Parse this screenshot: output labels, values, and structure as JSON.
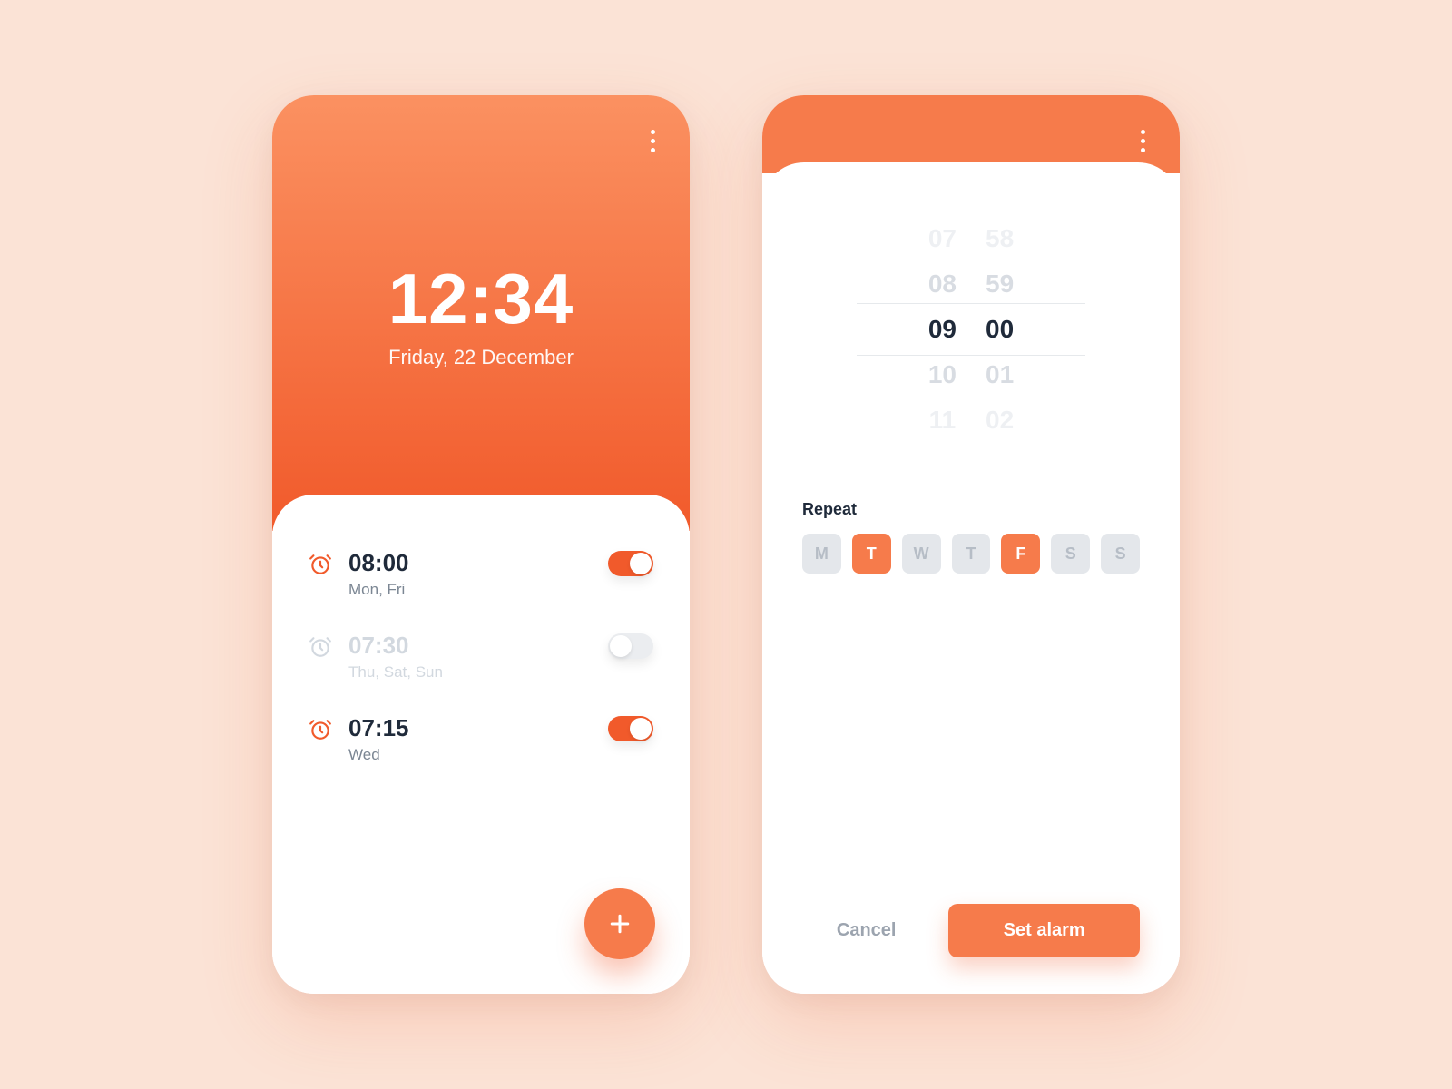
{
  "colors": {
    "accent": "#F67B4B"
  },
  "screen_main": {
    "time": "12:34",
    "date": "Friday, 22 December",
    "alarms": [
      {
        "time": "08:00",
        "days": "Mon, Fri",
        "enabled": true
      },
      {
        "time": "07:30",
        "days": "Thu, Sat, Sun",
        "enabled": false
      },
      {
        "time": "07:15",
        "days": "Wed",
        "enabled": true
      }
    ]
  },
  "screen_edit": {
    "picker": {
      "hours": [
        "07",
        "08",
        "09",
        "10",
        "11"
      ],
      "minutes": [
        "58",
        "59",
        "00",
        "01",
        "02"
      ],
      "selected_index": 2
    },
    "repeat_label": "Repeat",
    "days": [
      {
        "label": "M",
        "selected": false
      },
      {
        "label": "T",
        "selected": true
      },
      {
        "label": "W",
        "selected": false
      },
      {
        "label": "T",
        "selected": false
      },
      {
        "label": "F",
        "selected": true
      },
      {
        "label": "S",
        "selected": false
      },
      {
        "label": "S",
        "selected": false
      }
    ],
    "cancel_label": "Cancel",
    "confirm_label": "Set alarm"
  }
}
